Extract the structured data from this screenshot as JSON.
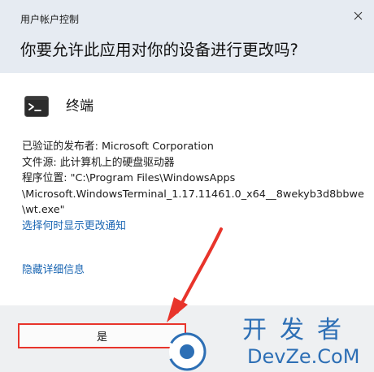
{
  "dialog": {
    "caption": "用户帐户控制",
    "question": "你要允许此应用对你的设备进行更改吗?",
    "app_name": "终端",
    "details": [
      "已验证的发布者: Microsoft Corporation",
      "文件源: 此计算机上的硬盘驱动器",
      "程序位置: \"C:\\Program Files\\WindowsApps",
      "\\Microsoft.WindowsTerminal_1.17.11461.0_x64__8wekyb3d8bbwe",
      "\\wt.exe\""
    ],
    "link_notify": "选择何时显示更改通知",
    "link_hide": "隐藏详细信息",
    "yes_label": "是",
    "close_glyph": "✕"
  },
  "watermark": {
    "cn": "开发者",
    "en": "DevZe.CoM"
  },
  "colors": {
    "header_bg": "#e6ebf2",
    "footer_bg": "#eef0f2",
    "link": "#1a66b3",
    "annotation_red": "#e8342b",
    "watermark_blue": "#2d6fb5"
  }
}
